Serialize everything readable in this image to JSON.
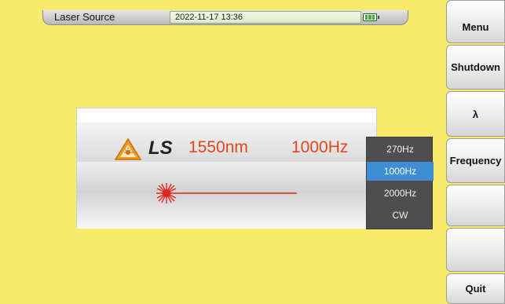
{
  "statusbar": {
    "title": "Laser Source",
    "datetime": "2022-11-17 13:36"
  },
  "laser": {
    "mode": "LS",
    "wavelength": "1550nm",
    "frequency": "1000Hz"
  },
  "frequency_menu": {
    "options": [
      "270Hz",
      "1000Hz",
      "2000Hz",
      "CW"
    ],
    "selected": "1000Hz"
  },
  "softkeys": {
    "menu": "Menu",
    "shutdown": "Shutdown",
    "lambda": "λ",
    "frequency": "Frequency",
    "empty1": "",
    "empty2": "",
    "quit": "Quit"
  },
  "colors": {
    "background": "#f7ea6c",
    "accent_text": "#e3461c",
    "selected_option": "#3d8ed4"
  }
}
